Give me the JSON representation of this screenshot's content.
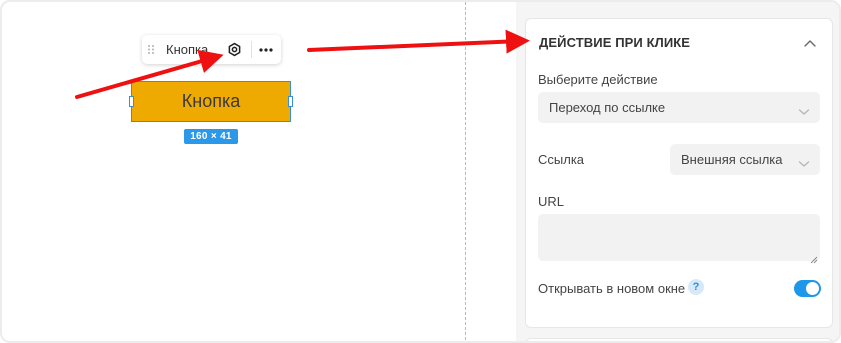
{
  "canvas": {
    "toolbar": {
      "label": "Кнопка",
      "drag_icon": "drag-handle-icon",
      "settings_icon": "gear-icon",
      "more_icon": "more-horizontal-icon"
    },
    "button": {
      "label": "Кнопка",
      "background": "#eeaa00"
    },
    "size_badge": "160 × 41",
    "selection_color": "#3a8fd9",
    "annotation_color": "#ee1111"
  },
  "panel": {
    "section_title": "ДЕЙСТВИЕ ПРИ КЛИКЕ",
    "collapse_icon": "chevron-up-icon",
    "action": {
      "label": "Выберите действие",
      "value": "Переход по ссылке"
    },
    "link": {
      "label": "Ссылка",
      "value": "Внешняя ссылка"
    },
    "url": {
      "label": "URL",
      "value": ""
    },
    "new_window": {
      "label": "Открывать в новом окне",
      "help": "?",
      "enabled": true,
      "accent": "#1c97ea"
    }
  }
}
